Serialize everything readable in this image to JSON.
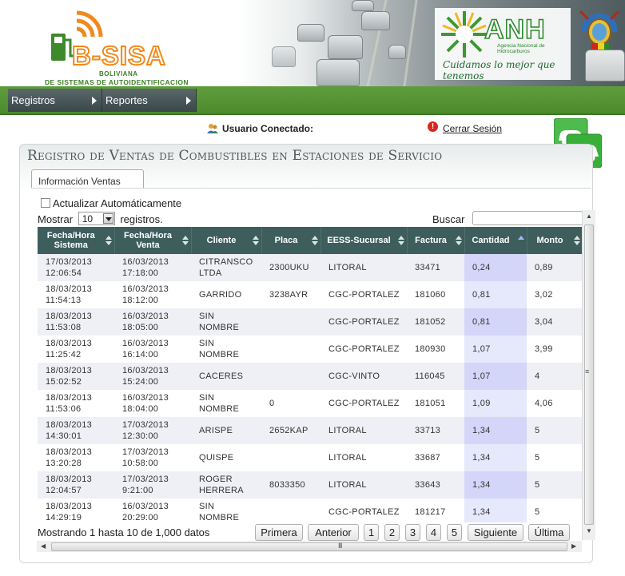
{
  "brand": {
    "name": "B-SISA",
    "subtitle_line1": "BOLIVIANA",
    "subtitle_line2": "DE SISTEMAS DE AUTOIDENTIFICACION",
    "anh_name": "ANH",
    "anh_sub": "Agencia Nacional de Hidrocarburos",
    "anh_slogan": "Cuidamos lo mejor que tenemos"
  },
  "colors": {
    "nav_green": "#4c8a2e",
    "header_teal": "#3e5e5e",
    "accent_orange": "#f08a1c",
    "qty_highlight": "#d3d6f8"
  },
  "menu": [
    {
      "label": "Registros",
      "icon": "arrow-right-icon"
    },
    {
      "label": "Reportes",
      "icon": "arrow-right-icon"
    }
  ],
  "user": {
    "label": "Usuario Conectado:",
    "logout": "Cerrar Sesión"
  },
  "page": {
    "title": "Registro de Ventas de Combustibles en Estaciones de Servicio",
    "tab": "Información Ventas"
  },
  "controls": {
    "auto_refresh": "Actualizar Automáticamente",
    "show_prefix": "Mostrar",
    "page_size": "10",
    "show_suffix": "registros.",
    "search_label": "Buscar",
    "search_value": ""
  },
  "table": {
    "headers": [
      "Fecha/Hora Sistema",
      "Fecha/Hora Venta",
      "Cliente",
      "Placa",
      "EESS-Sucursal",
      "Factura",
      "Cantidad",
      "Monto"
    ],
    "sorted_column": "Cantidad",
    "rows": [
      {
        "sistema_fecha": "17/03/2013",
        "sistema_hora": "12:06:54",
        "venta_fecha": "16/03/2013",
        "venta_hora": "17:18:00",
        "cliente1": "CITRANSCO",
        "cliente2": "LTDA",
        "placa": "2300UKU",
        "eess": "LITORAL",
        "factura": "33471",
        "cantidad": "0,24",
        "monto": "0,89"
      },
      {
        "sistema_fecha": "18/03/2013",
        "sistema_hora": "11:54:13",
        "venta_fecha": "16/03/2013",
        "venta_hora": "18:12:00",
        "cliente1": "GARRIDO",
        "cliente2": "",
        "placa": "3238AYR",
        "eess": "CGC-PORTALEZ",
        "factura": "181060",
        "cantidad": "0,81",
        "monto": "3,02"
      },
      {
        "sistema_fecha": "18/03/2013",
        "sistema_hora": "11:53:08",
        "venta_fecha": "16/03/2013",
        "venta_hora": "18:05:00",
        "cliente1": "SIN",
        "cliente2": "NOMBRE",
        "placa": "",
        "eess": "CGC-PORTALEZ",
        "factura": "181052",
        "cantidad": "0,81",
        "monto": "3,04"
      },
      {
        "sistema_fecha": "18/03/2013",
        "sistema_hora": "11:25:42",
        "venta_fecha": "16/03/2013",
        "venta_hora": "16:14:00",
        "cliente1": "SIN",
        "cliente2": "NOMBRE",
        "placa": "",
        "eess": "CGC-PORTALEZ",
        "factura": "180930",
        "cantidad": "1,07",
        "monto": "3,99"
      },
      {
        "sistema_fecha": "18/03/2013",
        "sistema_hora": "15:02:52",
        "venta_fecha": "16/03/2013",
        "venta_hora": "15:24:00",
        "cliente1": "CACERES",
        "cliente2": "",
        "placa": "",
        "eess": "CGC-VINTO",
        "factura": "116045",
        "cantidad": "1,07",
        "monto": "4"
      },
      {
        "sistema_fecha": "18/03/2013",
        "sistema_hora": "11:53:06",
        "venta_fecha": "16/03/2013",
        "venta_hora": "18:04:00",
        "cliente1": "SIN",
        "cliente2": "NOMBRE",
        "placa": "0",
        "eess": "CGC-PORTALEZ",
        "factura": "181051",
        "cantidad": "1,09",
        "monto": "4,06"
      },
      {
        "sistema_fecha": "18/03/2013",
        "sistema_hora": "14:30:01",
        "venta_fecha": "17/03/2013",
        "venta_hora": "12:30:00",
        "cliente1": "ARISPE",
        "cliente2": "",
        "placa": "2652KAP",
        "eess": "LITORAL",
        "factura": "33713",
        "cantidad": "1,34",
        "monto": "5"
      },
      {
        "sistema_fecha": "18/03/2013",
        "sistema_hora": "13:20:28",
        "venta_fecha": "17/03/2013",
        "venta_hora": "10:58:00",
        "cliente1": "QUISPE",
        "cliente2": "",
        "placa": "",
        "eess": "LITORAL",
        "factura": "33687",
        "cantidad": "1,34",
        "monto": "5"
      },
      {
        "sistema_fecha": "18/03/2013",
        "sistema_hora": "12:04:57",
        "venta_fecha": "17/03/2013",
        "venta_hora": "9:21:00",
        "cliente1": "ROGER",
        "cliente2": "HERRERA",
        "placa": "8033350",
        "eess": "LITORAL",
        "factura": "33643",
        "cantidad": "1,34",
        "monto": "5"
      },
      {
        "sistema_fecha": "18/03/2013",
        "sistema_hora": "14:29:19",
        "venta_fecha": "16/03/2013",
        "venta_hora": "20:29:00",
        "cliente1": "SIN",
        "cliente2": "NOMBRE",
        "placa": "",
        "eess": "CGC-PORTALEZ",
        "factura": "181217",
        "cantidad": "1,34",
        "monto": "5"
      }
    ]
  },
  "footer": {
    "info": "Mostrando 1 hasta 10 de 1,000 datos",
    "first": "Primera",
    "prev": "Anterior",
    "pages": [
      "1",
      "2",
      "3",
      "4",
      "5"
    ],
    "next": "Siguiente",
    "last": "Última"
  },
  "scrollbar": {
    "grip": "≡",
    "hgrip": "III"
  }
}
